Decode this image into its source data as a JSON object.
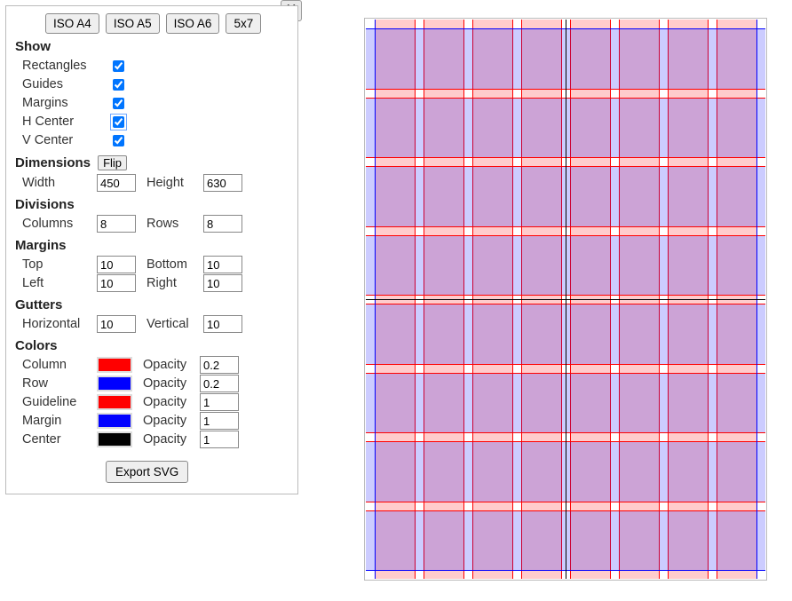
{
  "presets": {
    "a4": "ISO A4",
    "a5": "ISO A5",
    "a6": "ISO A6",
    "p57": "5x7"
  },
  "close_label": "X",
  "sections": {
    "show": "Show",
    "dimensions": "Dimensions",
    "divisions": "Divisions",
    "margins": "Margins",
    "gutters": "Gutters",
    "colors": "Colors"
  },
  "show": {
    "rectangles_label": "Rectangles",
    "rectangles": true,
    "guides_label": "Guides",
    "guides": true,
    "margins_label": "Margins",
    "margins": true,
    "hcenter_label": "H Center",
    "hcenter": true,
    "vcenter_label": "V Center",
    "vcenter": true
  },
  "dimensions": {
    "flip_label": "Flip",
    "width_label": "Width",
    "width": "450",
    "height_label": "Height",
    "height": "630"
  },
  "divisions": {
    "columns_label": "Columns",
    "columns": "8",
    "rows_label": "Rows",
    "rows": "8"
  },
  "margins": {
    "top_label": "Top",
    "top": "10",
    "bottom_label": "Bottom",
    "bottom": "10",
    "left_label": "Left",
    "left": "10",
    "right_label": "Right",
    "right": "10"
  },
  "gutters": {
    "horizontal_label": "Horizontal",
    "horizontal": "10",
    "vertical_label": "Vertical",
    "vertical": "10"
  },
  "colors": {
    "opacity_label": "Opacity",
    "column_label": "Column",
    "column_color": "#ff0000",
    "column_opacity": "0.2",
    "row_label": "Row",
    "row_color": "#0000ff",
    "row_opacity": "0.2",
    "guideline_label": "Guideline",
    "guideline_color": "#ff0000",
    "guideline_opacity": "1",
    "margin_label": "Margin",
    "margin_color": "#0000ff",
    "margin_opacity": "1",
    "center_label": "Center",
    "center_color": "#000000",
    "center_opacity": "1"
  },
  "export_label": "Export SVG"
}
